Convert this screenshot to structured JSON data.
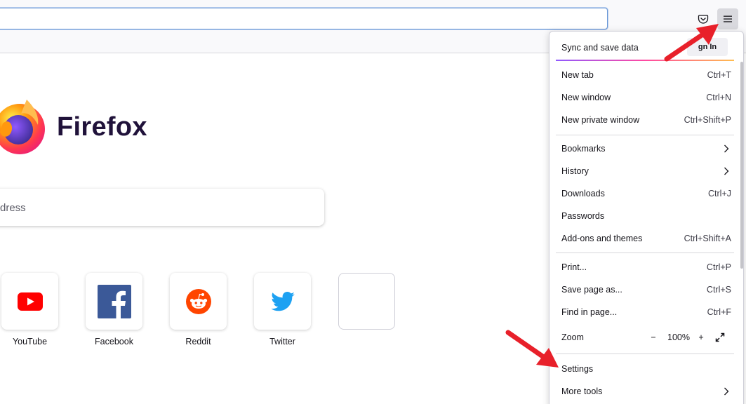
{
  "toolbar": {
    "pocket_icon": "pocket-icon",
    "menu_icon": "hamburger-menu-icon"
  },
  "newtab": {
    "brand_name": "Firefox",
    "search_placeholder": "dress",
    "tiles": [
      {
        "label": "YouTube",
        "icon": "youtube-icon",
        "color": "#ff0000"
      },
      {
        "label": "Facebook",
        "icon": "facebook-icon",
        "color": "#3b5998"
      },
      {
        "label": "Reddit",
        "icon": "reddit-icon",
        "color": "#ff4500"
      },
      {
        "label": "Twitter",
        "icon": "twitter-icon",
        "color": "#1da1f2"
      },
      {
        "label": "",
        "icon": "",
        "color": ""
      }
    ]
  },
  "menu": {
    "sync_label": "Sync and save data",
    "signin_label": "gn In",
    "items": [
      {
        "label": "New tab",
        "shortcut": "Ctrl+T"
      },
      {
        "label": "New window",
        "shortcut": "Ctrl+N"
      },
      {
        "label": "New private window",
        "shortcut": "Ctrl+Shift+P"
      },
      {
        "label": "Bookmarks",
        "shortcut": "",
        "submenu": true
      },
      {
        "label": "History",
        "shortcut": "",
        "submenu": true
      },
      {
        "label": "Downloads",
        "shortcut": "Ctrl+J"
      },
      {
        "label": "Passwords",
        "shortcut": ""
      },
      {
        "label": "Add-ons and themes",
        "shortcut": "Ctrl+Shift+A"
      },
      {
        "label": "Print...",
        "shortcut": "Ctrl+P"
      },
      {
        "label": "Save page as...",
        "shortcut": "Ctrl+S"
      },
      {
        "label": "Find in page...",
        "shortcut": "Ctrl+F"
      },
      {
        "label": "Settings",
        "shortcut": ""
      },
      {
        "label": "More tools",
        "shortcut": "",
        "submenu": true
      }
    ],
    "zoom": {
      "label": "Zoom",
      "minus": "−",
      "value": "100%",
      "plus": "+",
      "fullscreen_icon": "fullscreen-icon"
    }
  },
  "colors": {
    "annotation_arrow": "#e8202a",
    "focus_ring": "#6b98d6"
  }
}
